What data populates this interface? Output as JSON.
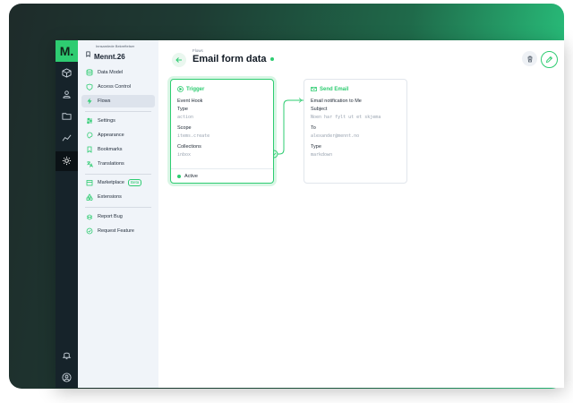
{
  "project": {
    "subtitle": "Innsamlede Bekreftelser",
    "name": "Mennt.26",
    "logo": "M."
  },
  "modules": [
    {
      "name": "content",
      "icon": "cube-icon"
    },
    {
      "name": "users",
      "icon": "users-icon"
    },
    {
      "name": "files",
      "icon": "folder-icon"
    },
    {
      "name": "insights",
      "icon": "chart-icon"
    },
    {
      "name": "settings",
      "icon": "gear-icon"
    },
    {
      "name": "notifications",
      "icon": "bell-icon"
    },
    {
      "name": "user",
      "icon": "user-circle-icon"
    }
  ],
  "nav": {
    "data_model": "Data Model",
    "access_control": "Access Control",
    "flows": "Flows",
    "settings": "Settings",
    "appearance": "Appearance",
    "bookmarks": "Bookmarks",
    "translations": "Translations",
    "marketplace": "Marketplace",
    "beta": "Beta",
    "extensions": "Extensions",
    "report_bug": "Report Bug",
    "request_feature": "Request Feature"
  },
  "header": {
    "breadcrumb": "Flows",
    "title": "Email form data"
  },
  "trigger": {
    "heading": "Trigger",
    "name": "Event Hook",
    "type_label": "Type",
    "type_value": "action",
    "scope_label": "Scope",
    "scope_value": "items.create",
    "collections_label": "Collections",
    "collections_value": "inbox",
    "status": "Active"
  },
  "operation": {
    "heading": "Send Email",
    "name": "Email notification to Me",
    "subject_label": "Subject",
    "subject_value": "Noen har fylt ut et skjema",
    "to_label": "To",
    "to_value": "alexander@mennt.no",
    "type_label": "Type",
    "type_value": "markdown"
  },
  "colors": {
    "accent": "#2ecc71",
    "module_bar": "#16232a",
    "nav_bg": "#f0f4f9"
  }
}
